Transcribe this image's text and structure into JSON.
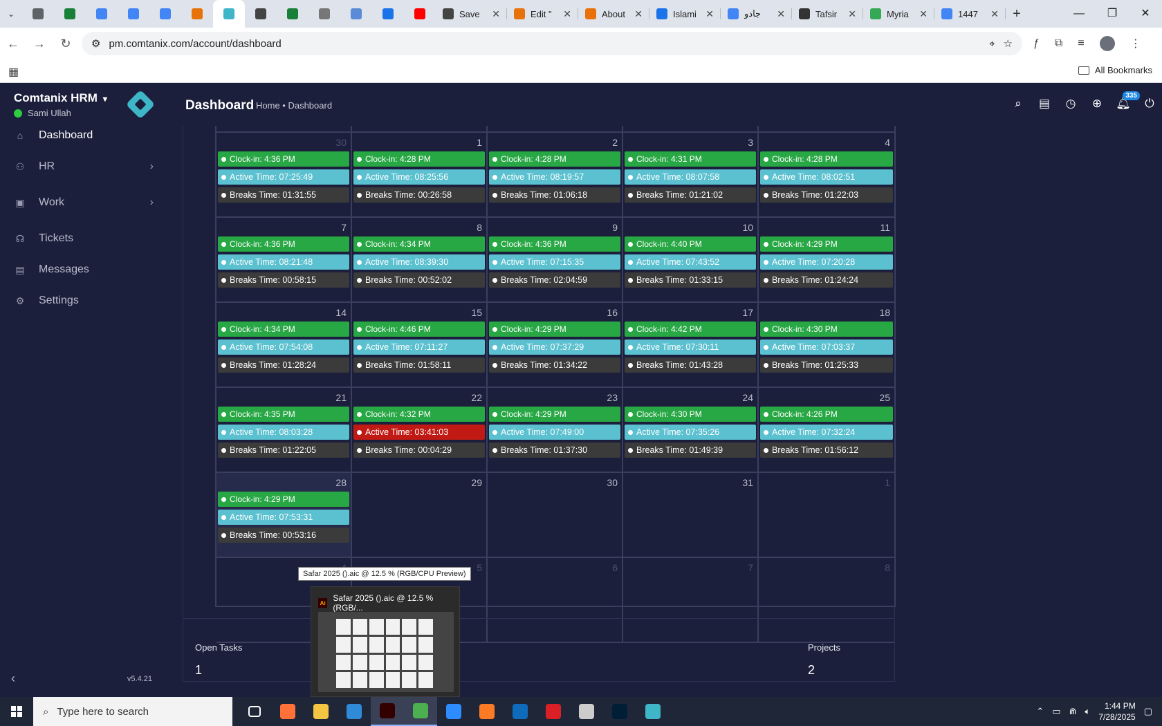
{
  "browser": {
    "tabs": [
      {
        "title": "",
        "color": "#5f6368"
      },
      {
        "title": "",
        "color": "#188038"
      },
      {
        "title": "",
        "color": "#4285f4"
      },
      {
        "title": "",
        "color": "#4285f4"
      },
      {
        "title": "",
        "color": "#4285f4"
      },
      {
        "title": "",
        "color": "#e8710a"
      },
      {
        "title": "",
        "color": "#3fb5c8",
        "active": true
      },
      {
        "title": "",
        "color": "#444"
      },
      {
        "title": "",
        "color": "#188038"
      },
      {
        "title": "",
        "color": "#777"
      },
      {
        "title": "",
        "color": "#5b8bd6"
      },
      {
        "title": "",
        "color": "#1a73e8"
      },
      {
        "title": "",
        "color": "#ff0000"
      }
    ],
    "named_tabs": [
      {
        "title": "Save",
        "color": "#444"
      },
      {
        "title": "Edit \"",
        "color": "#e8710a"
      },
      {
        "title": "About",
        "color": "#e8710a"
      },
      {
        "title": "Islami",
        "color": "#1a73e8"
      },
      {
        "title": "جادو",
        "color": "#4285f4"
      },
      {
        "title": "Tafsir",
        "color": "#333"
      },
      {
        "title": "Myria",
        "color": "#34a853"
      },
      {
        "title": "1447",
        "color": "#4285f4"
      }
    ],
    "new_tab": "+",
    "url": "pm.comtanix.com/account/dashboard",
    "all_bookmarks": "All Bookmarks"
  },
  "app": {
    "name": "Comtanix HRM",
    "user": "Sami Ullah",
    "version": "v5.4.21",
    "nav": [
      {
        "label": "Dashboard",
        "icon": "home-icon",
        "active": true,
        "arrow": false
      },
      {
        "label": "HR",
        "icon": "users-icon",
        "active": false,
        "arrow": true
      },
      {
        "label": "Work",
        "icon": "briefcase-icon",
        "active": false,
        "arrow": true
      },
      {
        "label": "Tickets",
        "icon": "headset-icon",
        "active": false,
        "arrow": false
      },
      {
        "label": "Messages",
        "icon": "message-icon",
        "active": false,
        "arrow": false
      },
      {
        "label": "Settings",
        "icon": "gear-icon",
        "active": false,
        "arrow": false
      }
    ]
  },
  "header": {
    "title": "Dashboard",
    "breadcrumb": "Home • Dashboard",
    "notifications_count": "335"
  },
  "calendar": {
    "weeks": [
      [
        {
          "day": "30",
          "dim": true,
          "clock": "Clock-in: 4:36 PM",
          "active": "Active Time: 07:25:49",
          "breaks": "Breaks Time: 01:31:55"
        },
        {
          "day": "1",
          "clock": "Clock-in: 4:28 PM",
          "active": "Active Time: 08:25:56",
          "breaks": "Breaks Time: 00:26:58"
        },
        {
          "day": "2",
          "clock": "Clock-in: 4:28 PM",
          "active": "Active Time: 08:19:57",
          "breaks": "Breaks Time: 01:06:18"
        },
        {
          "day": "3",
          "clock": "Clock-in: 4:31 PM",
          "active": "Active Time: 08:07:58",
          "breaks": "Breaks Time: 01:21:02"
        },
        {
          "day": "4",
          "clock": "Clock-in: 4:28 PM",
          "active": "Active Time: 08:02:51",
          "breaks": "Breaks Time: 01:22:03"
        }
      ],
      [
        {
          "day": "7",
          "clock": "Clock-in: 4:36 PM",
          "active": "Active Time: 08:21:48",
          "breaks": "Breaks Time: 00:58:15"
        },
        {
          "day": "8",
          "clock": "Clock-in: 4:34 PM",
          "active": "Active Time: 08:39:30",
          "breaks": "Breaks Time: 00:52:02"
        },
        {
          "day": "9",
          "clock": "Clock-in: 4:36 PM",
          "active": "Active Time: 07:15:35",
          "breaks": "Breaks Time: 02:04:59"
        },
        {
          "day": "10",
          "clock": "Clock-in: 4:40 PM",
          "active": "Active Time: 07:43:52",
          "breaks": "Breaks Time: 01:33:15"
        },
        {
          "day": "11",
          "clock": "Clock-in: 4:29 PM",
          "active": "Active Time: 07:20:28",
          "breaks": "Breaks Time: 01:24:24"
        }
      ],
      [
        {
          "day": "14",
          "clock": "Clock-in: 4:34 PM",
          "active": "Active Time: 07:54:08",
          "breaks": "Breaks Time: 01:28:24"
        },
        {
          "day": "15",
          "clock": "Clock-in: 4:46 PM",
          "active": "Active Time: 07:11:27",
          "breaks": "Breaks Time: 01:58:11"
        },
        {
          "day": "16",
          "clock": "Clock-in: 4:29 PM",
          "active": "Active Time: 07:37:29",
          "breaks": "Breaks Time: 01:34:22"
        },
        {
          "day": "17",
          "clock": "Clock-in: 4:42 PM",
          "active": "Active Time: 07:30:11",
          "breaks": "Breaks Time: 01:43:28"
        },
        {
          "day": "18",
          "clock": "Clock-in: 4:30 PM",
          "active": "Active Time: 07:03:37",
          "breaks": "Breaks Time: 01:25:33"
        }
      ],
      [
        {
          "day": "21",
          "clock": "Clock-in: 4:35 PM",
          "active": "Active Time: 08:03:28",
          "breaks": "Breaks Time: 01:22:05"
        },
        {
          "day": "22",
          "clock": "Clock-in: 4:32 PM",
          "active": "Active Time: 03:41:03",
          "active_warn": true,
          "breaks": "Breaks Time: 00:04:29"
        },
        {
          "day": "23",
          "clock": "Clock-in: 4:29 PM",
          "active": "Active Time: 07:49:00",
          "breaks": "Breaks Time: 01:37:30"
        },
        {
          "day": "24",
          "clock": "Clock-in: 4:30 PM",
          "active": "Active Time: 07:35:26",
          "breaks": "Breaks Time: 01:49:39"
        },
        {
          "day": "25",
          "clock": "Clock-in: 4:26 PM",
          "active": "Active Time: 07:32:24",
          "breaks": "Breaks Time: 01:56:12"
        }
      ],
      [
        {
          "day": "28",
          "today": true,
          "clock": "Clock-in: 4:29 PM",
          "active": "Active Time: 07:53:31",
          "breaks": "Breaks Time: 00:53:16"
        },
        {
          "day": "29"
        },
        {
          "day": "30"
        },
        {
          "day": "31"
        },
        {
          "day": "1",
          "dim": true
        }
      ],
      [
        {
          "day": "4",
          "dim": true
        },
        {
          "day": "5",
          "dim": true
        },
        {
          "day": "6",
          "dim": true
        },
        {
          "day": "7",
          "dim": true
        },
        {
          "day": "8",
          "dim": true
        }
      ]
    ]
  },
  "stats": {
    "open_tasks_label": "Open Tasks",
    "open_tasks_value": "1",
    "projects_label": "Projects",
    "projects_value": "2"
  },
  "tooltip": "Safar 2025 ().aic @ 12.5 % (RGB/CPU Preview)",
  "preview_title": "Safar 2025 ().aic @ 12.5 % (RGB/...",
  "taskbar": {
    "search_placeholder": "Type here to search",
    "time": "1:44 PM",
    "date": "7/28/2025",
    "apps": [
      {
        "name": "task-view",
        "color": "#ffffff",
        "on": false
      },
      {
        "name": "firefox",
        "color": "#ff7139",
        "on": false
      },
      {
        "name": "file-explorer",
        "color": "#f4c542",
        "on": false
      },
      {
        "name": "vscode",
        "color": "#2f8ad8",
        "on": false
      },
      {
        "name": "illustrator",
        "color": "#330000",
        "on": true
      },
      {
        "name": "chrome",
        "color": "#4caf50",
        "on": true
      },
      {
        "name": "zoom",
        "color": "#2d8cff",
        "on": false
      },
      {
        "name": "xampp",
        "color": "#fb7a24",
        "on": false
      },
      {
        "name": "outlook",
        "color": "#0f6cbd",
        "on": false
      },
      {
        "name": "creative-cloud",
        "color": "#da1f26",
        "on": false
      },
      {
        "name": "pen-tool",
        "color": "#cccccc",
        "on": false
      },
      {
        "name": "photoshop",
        "color": "#001e36",
        "on": false
      },
      {
        "name": "comtanix",
        "color": "#3fb5c8",
        "on": false
      }
    ]
  }
}
